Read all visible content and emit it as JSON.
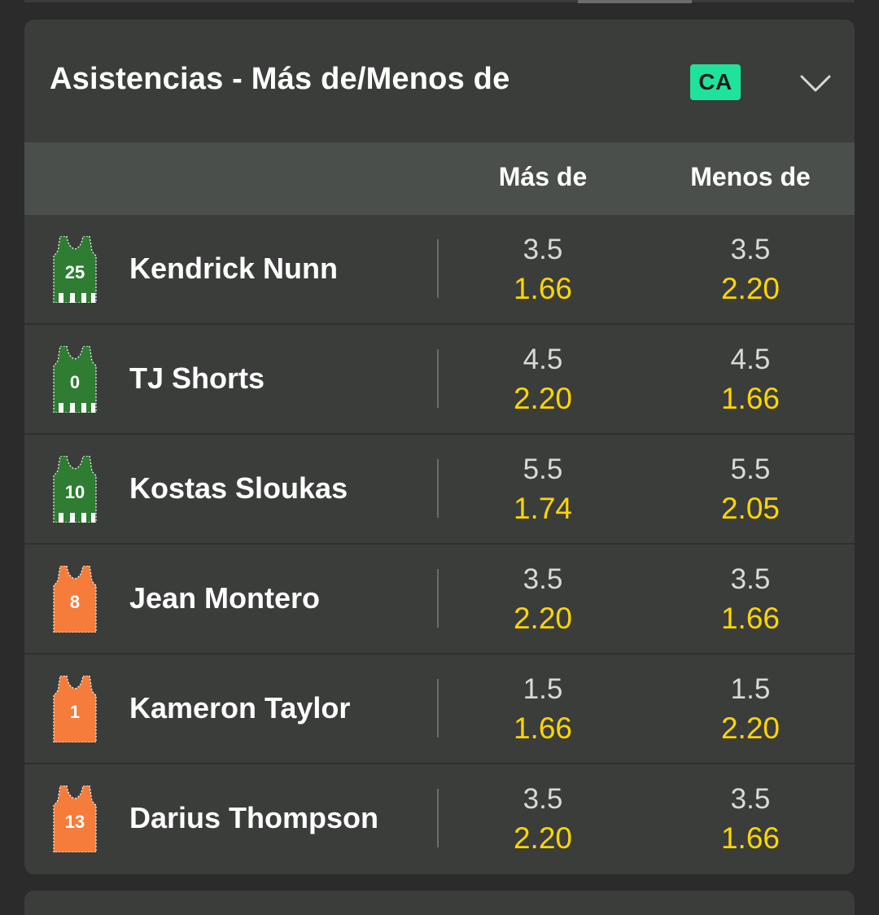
{
  "market": {
    "title": "Asistencias - Más de/Menos de",
    "badge": "CA",
    "colors": {
      "badge_bg": "#20e39b",
      "price": "#ffd600",
      "home_jersey": "#2e7d32",
      "away_jersey": "#f57c3b"
    }
  },
  "columns": {
    "over": "Más de",
    "under": "Menos de"
  },
  "players": [
    {
      "name": "Kendrick Nunn",
      "number": "25",
      "team": "home",
      "over_line": "3.5",
      "over_price": "1.66",
      "under_line": "3.5",
      "under_price": "2.20"
    },
    {
      "name": "TJ Shorts",
      "number": "0",
      "team": "home",
      "over_line": "4.5",
      "over_price": "2.20",
      "under_line": "4.5",
      "under_price": "1.66"
    },
    {
      "name": "Kostas Sloukas",
      "number": "10",
      "team": "home",
      "over_line": "5.5",
      "over_price": "1.74",
      "under_line": "5.5",
      "under_price": "2.05"
    },
    {
      "name": "Jean Montero",
      "number": "8",
      "team": "away",
      "over_line": "3.5",
      "over_price": "2.20",
      "under_line": "3.5",
      "under_price": "1.66"
    },
    {
      "name": "Kameron Taylor",
      "number": "1",
      "team": "away",
      "over_line": "1.5",
      "over_price": "1.66",
      "under_line": "1.5",
      "under_price": "2.20"
    },
    {
      "name": "Darius Thompson",
      "number": "13",
      "team": "away",
      "over_line": "3.5",
      "over_price": "2.20",
      "under_line": "3.5",
      "under_price": "1.66"
    }
  ]
}
